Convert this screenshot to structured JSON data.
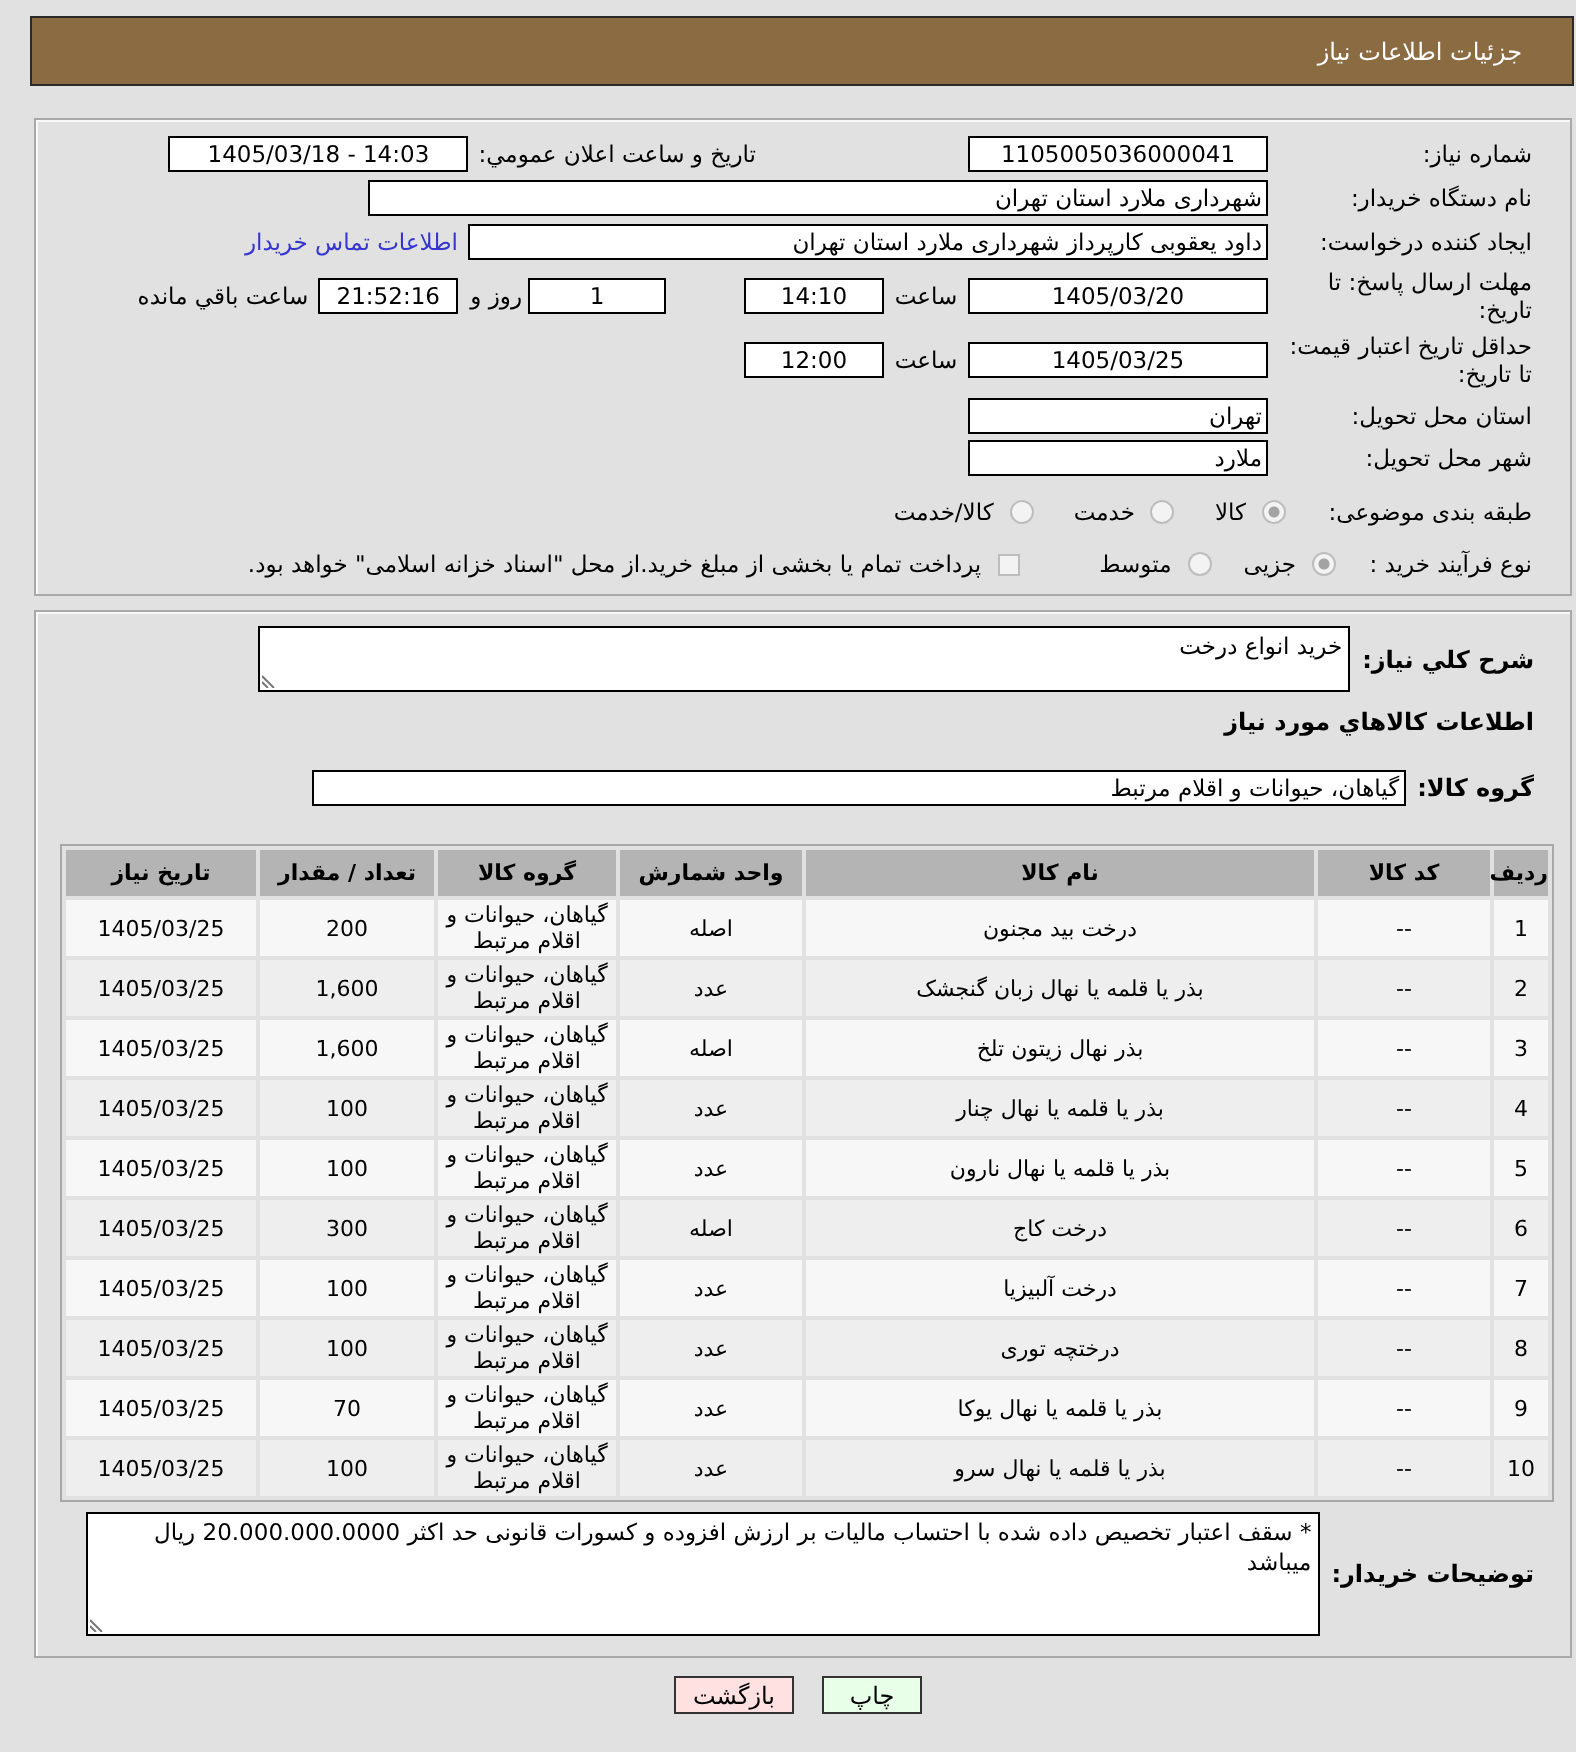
{
  "header": {
    "title": "جزئیات اطلاعات نیاز"
  },
  "need_info": {
    "need_number": {
      "label": "شماره نیاز:",
      "value": "1105005036000041"
    },
    "announcement": {
      "label": "تاریخ و ساعت اعلان عمومي:",
      "value": "1405/03/18 - 14:03"
    },
    "buyer_org": {
      "label": "نام دستگاه خریدار:",
      "value": "شهرداری ملارد استان تهران"
    },
    "requester": {
      "label": "ایجاد کننده درخواست:",
      "value": "داود یعقوبی کارپرداز  شهرداری ملارد استان تهران",
      "contact_link": "اطلاعات تماس خریدار"
    },
    "reply_deadline": {
      "label": "مهلت ارسال پاسخ: تا تاریخ:",
      "date": "1405/03/20",
      "time_label": "ساعت",
      "time": "14:10",
      "days": "1",
      "days_label": "روز و",
      "remaining_time": "21:52:16",
      "remaining_label": "ساعت باقي مانده"
    },
    "price_validity": {
      "label": "حداقل تاریخ اعتبار قیمت: تا تاریخ:",
      "date": "1405/03/25",
      "time_label": "ساعت",
      "time": "12:00"
    },
    "delivery_province": {
      "label": "استان محل تحویل:",
      "value": "تهران"
    },
    "delivery_city": {
      "label": "شهر محل تحویل:",
      "value": "ملارد"
    },
    "category": {
      "label": "طبقه بندی موضوعی:",
      "options": [
        {
          "label": "کالا",
          "selected": true
        },
        {
          "label": "خدمت",
          "selected": false
        },
        {
          "label": "کالا/خدمت",
          "selected": false
        }
      ]
    },
    "purchase_process": {
      "label": "نوع فرآیند خرید :",
      "options": [
        {
          "label": "جزیی",
          "selected": true
        },
        {
          "label": "متوسط",
          "selected": false
        }
      ],
      "treasury_payment": {
        "label": "پرداخت تمام یا بخشی از مبلغ خرید.از محل \"اسناد خزانه اسلامی\" خواهد بود.",
        "checked": false
      }
    }
  },
  "goods": {
    "description": {
      "label": "شرح کلي نیاز:",
      "value": "خرید انواع درخت"
    },
    "section_title": "اطلاعات کالاهاي مورد نياز",
    "group": {
      "label": "گروه کالا:",
      "value": "گیاهان، حیوانات و اقلام مرتبط"
    },
    "table": {
      "columns": [
        "ردیف",
        "کد کالا",
        "نام کالا",
        "واحد شمارش",
        "گروه کالا",
        "تعداد / مقدار",
        "تاریخ نیاز"
      ],
      "rows": [
        [
          "1",
          "--",
          "درخت بید مجنون",
          "اصله",
          "گیاهان، حیوانات و اقلام مرتبط",
          "200",
          "1405/03/25"
        ],
        [
          "2",
          "--",
          "بذر یا قلمه یا نهال زبان گنجشک",
          "عدد",
          "گیاهان، حیوانات و اقلام مرتبط",
          "1,600",
          "1405/03/25"
        ],
        [
          "3",
          "--",
          "بذر نهال زیتون تلخ",
          "اصله",
          "گیاهان، حیوانات و اقلام مرتبط",
          "1,600",
          "1405/03/25"
        ],
        [
          "4",
          "--",
          "بذر یا قلمه یا نهال چنار",
          "عدد",
          "گیاهان، حیوانات و اقلام مرتبط",
          "100",
          "1405/03/25"
        ],
        [
          "5",
          "--",
          "بذر یا قلمه یا نهال نارون",
          "عدد",
          "گیاهان، حیوانات و اقلام مرتبط",
          "100",
          "1405/03/25"
        ],
        [
          "6",
          "--",
          "درخت کاج",
          "اصله",
          "گیاهان، حیوانات و اقلام مرتبط",
          "300",
          "1405/03/25"
        ],
        [
          "7",
          "--",
          "درخت آلبیزیا",
          "عدد",
          "گیاهان، حیوانات و اقلام مرتبط",
          "100",
          "1405/03/25"
        ],
        [
          "8",
          "--",
          "درختچه توری",
          "عدد",
          "گیاهان، حیوانات و اقلام مرتبط",
          "100",
          "1405/03/25"
        ],
        [
          "9",
          "--",
          "بذر یا قلمه یا نهال یوکا",
          "عدد",
          "گیاهان، حیوانات و اقلام مرتبط",
          "70",
          "1405/03/25"
        ],
        [
          "10",
          "--",
          "بذر یا قلمه یا نهال سرو",
          "عدد",
          "گیاهان، حیوانات و اقلام مرتبط",
          "100",
          "1405/03/25"
        ]
      ]
    },
    "buyer_notes": {
      "label": "توضیحات خریدار:",
      "value": "* سقف اعتبار تخصیص داده شده با احتساب مالیات بر ارزش افزوده و کسورات قانونی حد اکثر 20.000.000.0000  ریال میباشد"
    }
  },
  "buttons": [
    {
      "label": "چاپ",
      "kind": "print"
    },
    {
      "label": "بازگشت",
      "kind": "back"
    }
  ]
}
